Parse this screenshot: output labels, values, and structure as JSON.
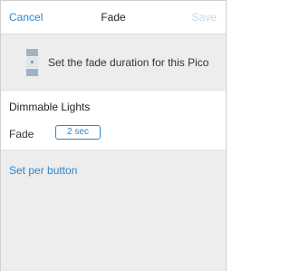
{
  "nav": {
    "cancel_label": "Cancel",
    "title": "Fade",
    "save_label": "Save"
  },
  "info": {
    "icon": "pico-remote-icon",
    "text": "Set the fade duration for this Pico"
  },
  "lights": {
    "heading": "Dimmable Lights",
    "fade_label": "Fade",
    "fade_value": "2 sec"
  },
  "per_button": {
    "label": "Set per button"
  },
  "colors": {
    "accent": "#2f86c9",
    "save_disabled": "#c8d9e6",
    "panel_gray": "#ededed"
  }
}
